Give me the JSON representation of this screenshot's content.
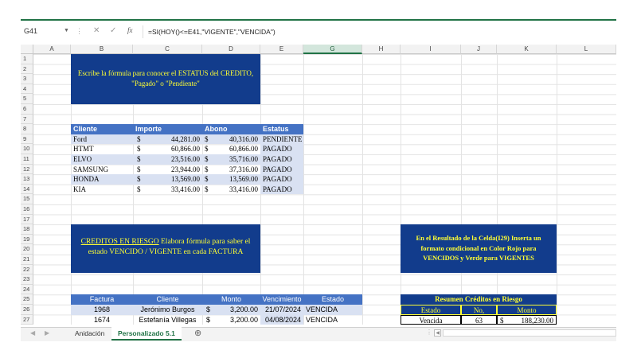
{
  "formula_bar": {
    "name_box": "G41",
    "cancel_icon": "✕",
    "enter_icon": "✓",
    "fx_label": "fx",
    "formula": "=SI(HOY()<=E41,\"VIGENTE\",\"VENCIDA\")"
  },
  "columns": [
    "A",
    "B",
    "C",
    "D",
    "E",
    "G",
    "H",
    "I",
    "J",
    "K",
    "L"
  ],
  "selected_column": "G",
  "rows": [
    "1",
    "2",
    "3",
    "4",
    "5",
    "6",
    "7",
    "8",
    "9",
    "10",
    "11",
    "12",
    "13",
    "14",
    "15",
    "16",
    "17",
    "18",
    "19",
    "20",
    "21",
    "22",
    "23",
    "24",
    "25",
    "26",
    "27"
  ],
  "box1": {
    "line1": "Escribe la fórmula para conocer el ESTATUS del CREDITO,",
    "line2": "\"Pagado\" o \"Pendiente\""
  },
  "credit_table": {
    "headers": [
      "Cliente",
      "Importe",
      "Abono",
      "Estatus"
    ],
    "rows": [
      [
        "Ford",
        "$",
        "44,281.00",
        "$",
        "40,316.00",
        "PENDIENTE"
      ],
      [
        "HTMT",
        "$",
        "60,866.00",
        "$",
        "60,866.00",
        "PAGADO"
      ],
      [
        "ELVO",
        "$",
        "23,516.00",
        "$",
        "35,716.00",
        "PAGADO"
      ],
      [
        "SAMSUNG",
        "$",
        "23,944.00",
        "$",
        "37,316.00",
        "PAGADO"
      ],
      [
        "HONDA",
        "$",
        "13,569.00",
        "$",
        "13,569.00",
        "PAGADO"
      ],
      [
        "KIA",
        "$",
        "33,416.00",
        "$",
        "33,416.00",
        "PAGADO"
      ]
    ]
  },
  "box2": {
    "title": "CREDITOS EN RIESGO",
    "line1_rest": "  Elabora fórmula para saber el",
    "line2": "estado VENCIDO / VIGENTE  en cada FACTURA"
  },
  "box3": {
    "line1": "En el Resultado de la Celda(I29) Inserta un",
    "line2": "formato condicional en Color Rojo para",
    "line3": "VENCIDOS y Verde para VIGENTES"
  },
  "invoice_table": {
    "headers": [
      "Factura",
      "Cliente",
      "Monto",
      "Vencimiento",
      "Estado"
    ],
    "rows": [
      [
        "1968",
        "Jerónimo Burgos",
        "$",
        "3,200.00",
        "21/07/2024",
        "VENCIDA"
      ],
      [
        "1674",
        "Estefanía Villegas",
        "$",
        "3,200.00",
        "04/08/2024",
        "VENCIDA"
      ]
    ]
  },
  "summary": {
    "title": "Resumen Créditos en Riesgo",
    "headers": [
      "Estado",
      "No,",
      "Monto"
    ],
    "row": [
      "Vencida",
      "63",
      "$",
      "188,230.00"
    ]
  },
  "sheet_tabs": {
    "tabs": [
      "Anidación",
      "Personalizado 5.1"
    ],
    "active": "Personalizado 5.1",
    "add_icon": "⊕"
  }
}
